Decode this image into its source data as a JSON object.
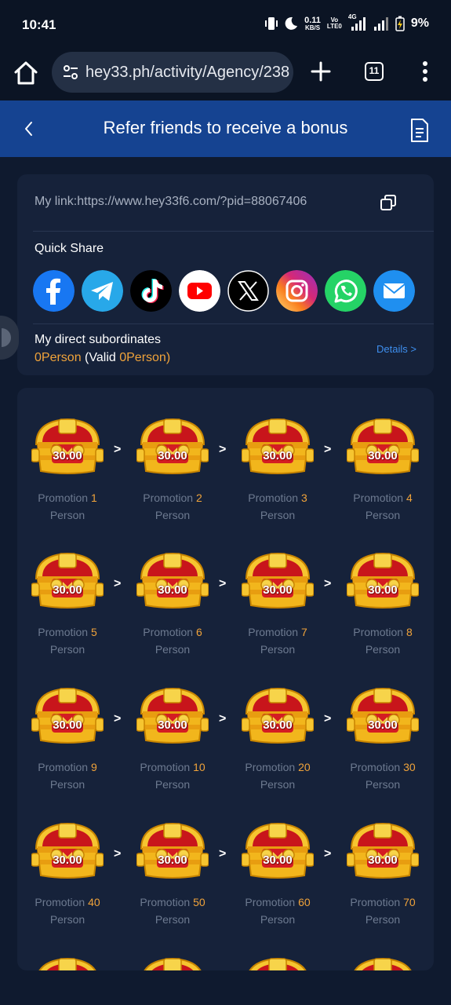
{
  "status_bar": {
    "time": "10:41",
    "network_speed_value": "0.11",
    "network_speed_unit": "KB/S",
    "volte_top": "Vo",
    "volte_bottom": "LTE0",
    "network_type": "4G",
    "battery": "9%"
  },
  "browser": {
    "url": "hey33.ph/activity/Agency/238",
    "tab_count": "11"
  },
  "header": {
    "title": "Refer friends to receive a bonus"
  },
  "link_card": {
    "link_text": "My link:https://www.hey33f6.com/?pid=88067406",
    "quick_share_title": "Quick Share",
    "share_icons": [
      "facebook-icon",
      "telegram-icon",
      "tiktok-icon",
      "youtube-icon",
      "x-icon",
      "instagram-icon",
      "whatsapp-icon",
      "email-icon"
    ],
    "subordinates_title": "My direct subordinates",
    "count_value": "0",
    "count_unit": "Person",
    "valid_prefix": " (Valid ",
    "valid_value": "0",
    "valid_suffix": "Person)",
    "details_label": "Details >"
  },
  "rewards": {
    "arrow": ">",
    "label_prefix": "Promotion ",
    "label_unit": "Person",
    "items": [
      {
        "amount": "30.00",
        "count": "1"
      },
      {
        "amount": "30.00",
        "count": "2"
      },
      {
        "amount": "30.00",
        "count": "3"
      },
      {
        "amount": "30.00",
        "count": "4"
      },
      {
        "amount": "30.00",
        "count": "5"
      },
      {
        "amount": "30.00",
        "count": "6"
      },
      {
        "amount": "30.00",
        "count": "7"
      },
      {
        "amount": "30.00",
        "count": "8"
      },
      {
        "amount": "30.00",
        "count": "9"
      },
      {
        "amount": "30.00",
        "count": "10"
      },
      {
        "amount": "30.00",
        "count": "20"
      },
      {
        "amount": "30.00",
        "count": "30"
      },
      {
        "amount": "30.00",
        "count": "40"
      },
      {
        "amount": "30.00",
        "count": "50"
      },
      {
        "amount": "30.00",
        "count": "60"
      },
      {
        "amount": "30.00",
        "count": "70"
      }
    ]
  },
  "colors": {
    "header_bg": "#154391",
    "page_bg": "#0f1a2f",
    "card_bg": "#16223a",
    "accent_orange": "#f0a33a",
    "link_blue": "#3e8fef"
  }
}
